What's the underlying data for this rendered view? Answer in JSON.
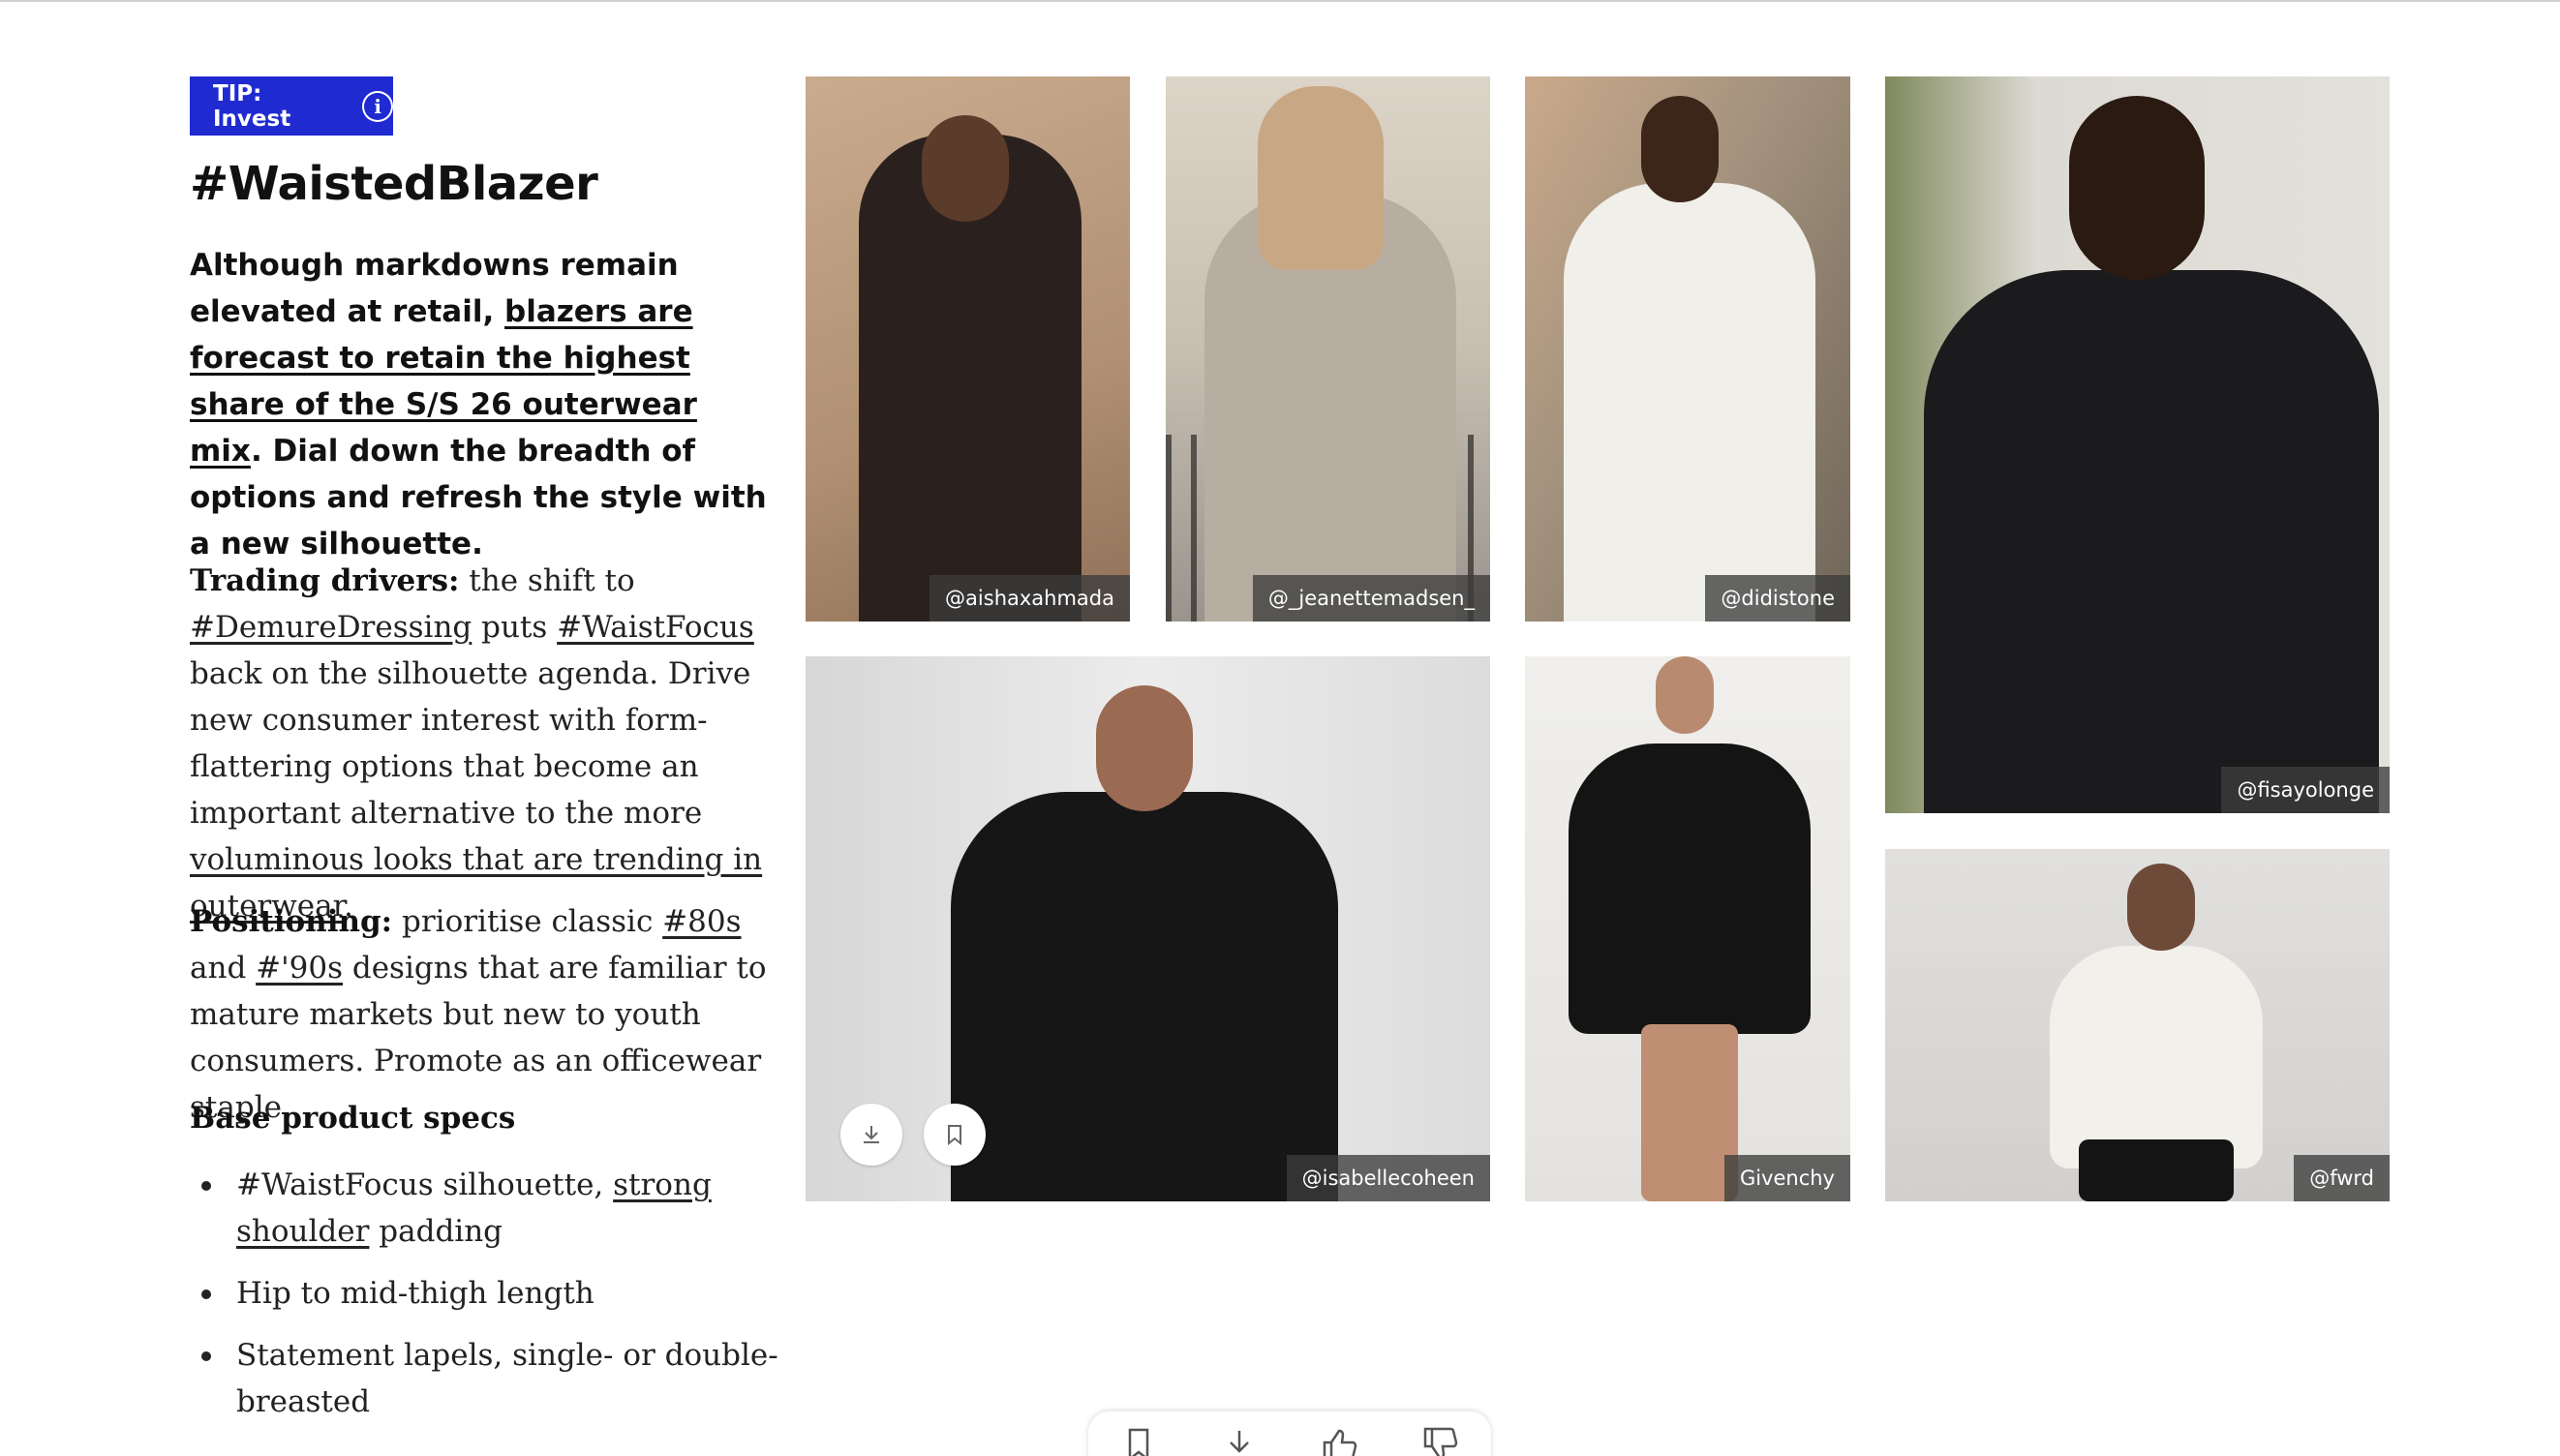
{
  "tip": {
    "label": "TIP: Invest",
    "info_icon": "info-icon"
  },
  "title": "#WaistedBlazer",
  "lead": {
    "part1": "Although markdowns remain elevated at retail, ",
    "link": "blazers are forecast to retain the highest share of the S/S 26 outerwear mix",
    "part2": ". Dial down the breadth of options and refresh the style with a new silhouette."
  },
  "trading": {
    "heading": "Trading drivers:",
    "t1": " the shift to ",
    "link1": "#DemureDressing",
    "t2": " puts ",
    "link2": "#WaistFocus",
    "t3": " back on the silhouette agenda. Drive new consumer interest with form-flattering options that become an important alternative to the more ",
    "link3": "voluminous looks that are trending in outerwear",
    "t4": "."
  },
  "positioning": {
    "heading": "Positioning:",
    "t1": " prioritise classic ",
    "link1": "#80s",
    "t2": " and ",
    "link2": "#'90s",
    "t3": " designs that are familiar to mature markets but new to youth consumers. Promote as an officewear staple."
  },
  "specs": {
    "heading": "Base product specs",
    "item1_pre": "#WaistFocus silhouette, ",
    "item1_link": "strong shoulder",
    "item1_post": " padding",
    "item2": "Hip to mid-thigh length",
    "item3": "Statement lapels, single- or double-breasted"
  },
  "images": [
    {
      "credit": "@aishaxahmada",
      "garment": "#2a211f",
      "bg": "#b99a7d"
    },
    {
      "credit": "@_jeanettemadsen_",
      "garment": "#b7ada1",
      "bg": "#cfc6ba"
    },
    {
      "credit": "@didistone",
      "garment": "#f1efe9",
      "bg": "#a4937e"
    },
    {
      "credit": "@fisayolonge",
      "garment": "#1b1b1d",
      "bg": "#dcdad3"
    },
    {
      "credit": "@isabellecoheen",
      "garment": "#171616",
      "bg": "#e6e6e6"
    },
    {
      "credit": "Givenchy",
      "garment": "#141414",
      "bg": "#ecebe8"
    },
    {
      "credit": "@fwrd",
      "garment": "#f2f0ea",
      "bg": "#dedcda"
    }
  ],
  "toolbar_icons": [
    "bookmark-icon",
    "download-icon",
    "thumbs-up-icon",
    "thumbs-down-icon"
  ]
}
